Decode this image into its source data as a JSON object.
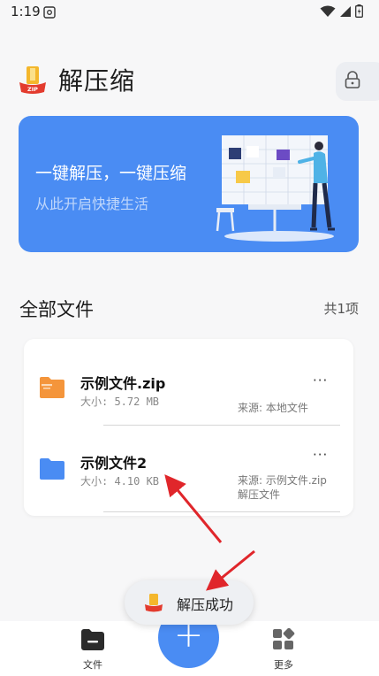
{
  "status_bar": {
    "time": "1:19"
  },
  "app": {
    "title": "解压缩",
    "logo_text": "ZIP"
  },
  "banner": {
    "title": "一键解压，一键压缩",
    "subtitle": "从此开启快捷生活"
  },
  "section": {
    "title": "全部文件",
    "count": "共1项"
  },
  "files": [
    {
      "name": "示例文件.zip",
      "size": "大小: 5.72 MB",
      "source": "来源: 本地文件",
      "icon": "zip-folder-icon",
      "icon_color": "#f4953b",
      "more": "···"
    },
    {
      "name": "示例文件2",
      "size": "大小: 4.10 KB",
      "source": "来源: 示例文件.zip解压文件",
      "icon": "folder-icon",
      "icon_color": "#4a8cf3",
      "more": "···"
    }
  ],
  "toast": {
    "text": "解压成功"
  },
  "nav": {
    "files_label": "文件",
    "more_label": "更多",
    "fab_label": "+"
  },
  "colors": {
    "accent": "#4a8cf3",
    "zip": "#f4953b",
    "arrow": "#e0262b"
  }
}
